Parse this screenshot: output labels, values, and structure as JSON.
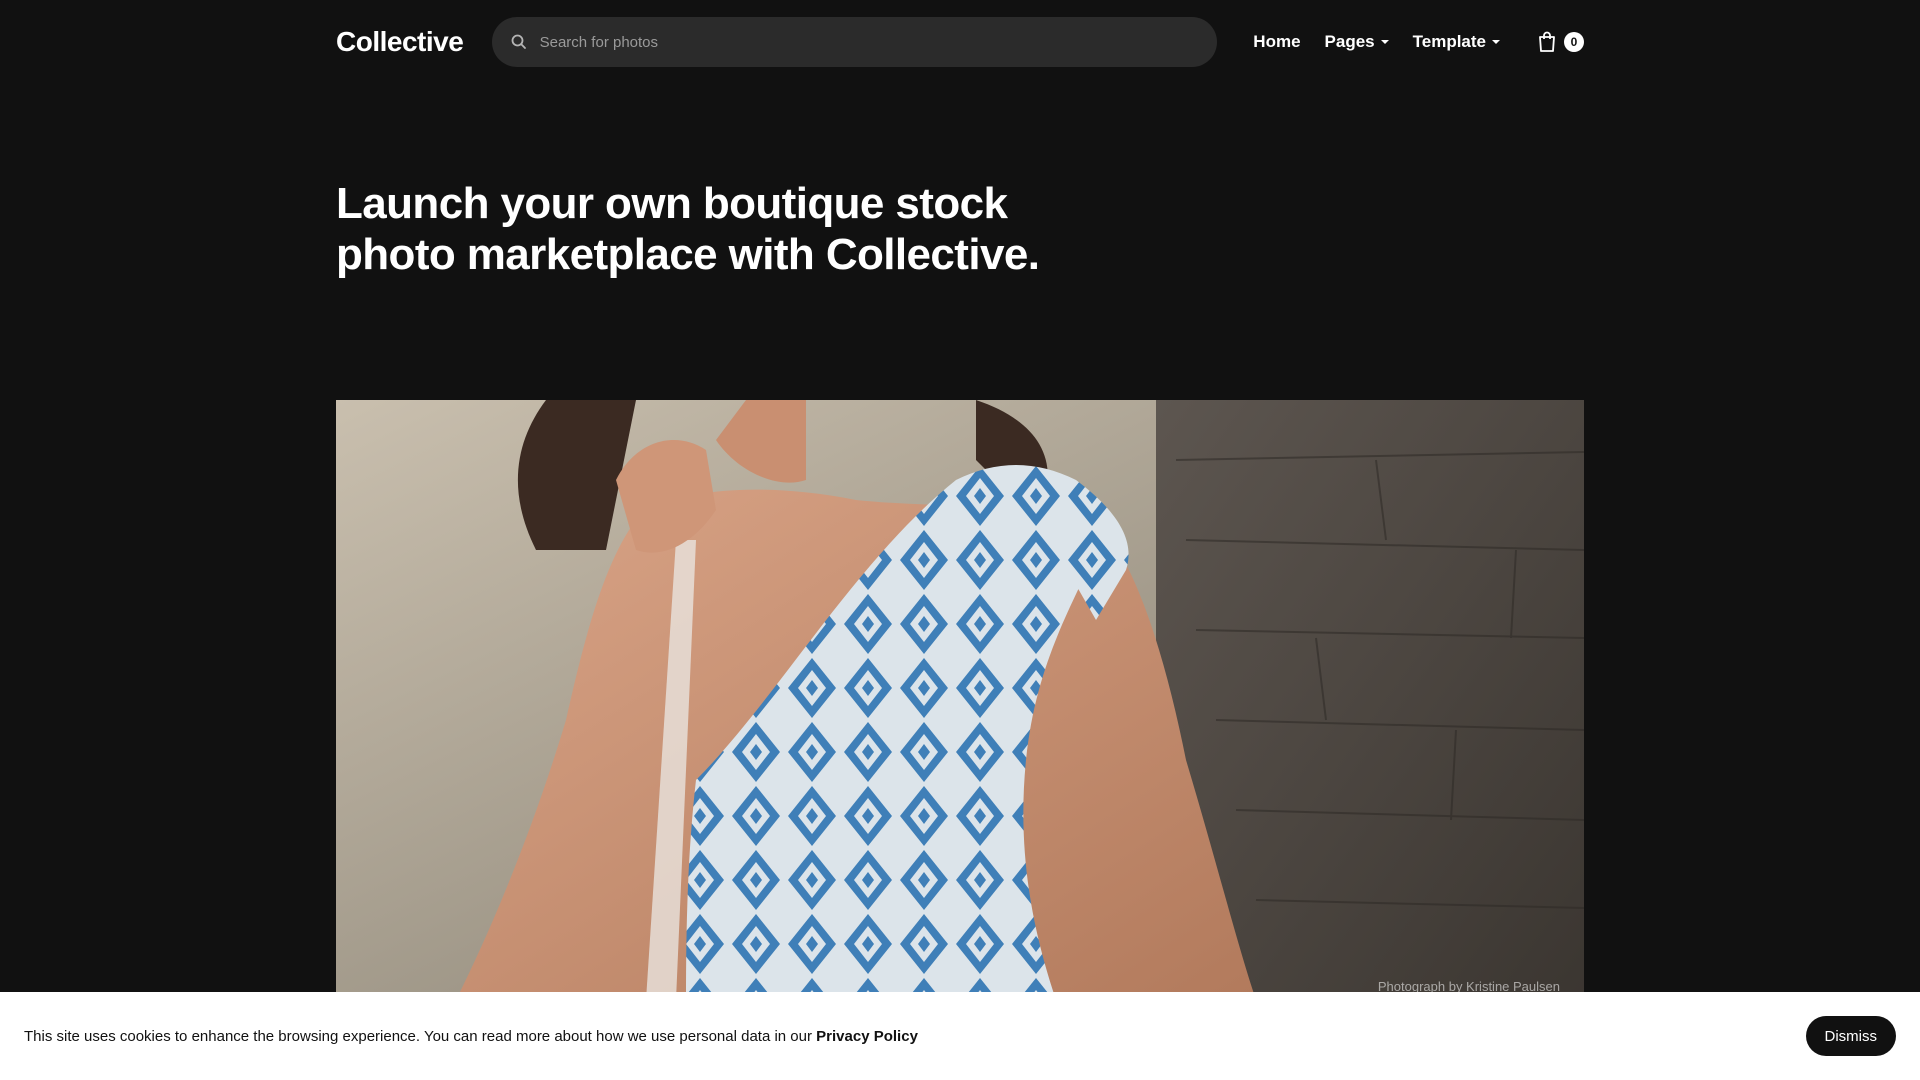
{
  "header": {
    "logo": "Collective",
    "search": {
      "placeholder": "Search for photos",
      "icon": "search-icon"
    },
    "nav": [
      {
        "label": "Home",
        "dropdown": false
      },
      {
        "label": "Pages",
        "dropdown": true
      },
      {
        "label": "Template",
        "dropdown": true
      }
    ],
    "cart": {
      "icon": "shopping-bag-icon",
      "count": "0"
    }
  },
  "hero": {
    "title": "Launch your own boutique stock photo marketplace with Collective."
  },
  "photo": {
    "credit": "Photograph by Kristine Paulsen"
  },
  "cookie_bar": {
    "text": "This site uses cookies to enhance the browsing experience. You can read more about how we use personal data in our",
    "link": "Privacy Policy",
    "dismiss": "Dismiss"
  },
  "colors": {
    "background": "#111111",
    "search_bg": "#2b2b2b",
    "cookie_bg": "#ffffff",
    "button_bg": "#111111"
  }
}
